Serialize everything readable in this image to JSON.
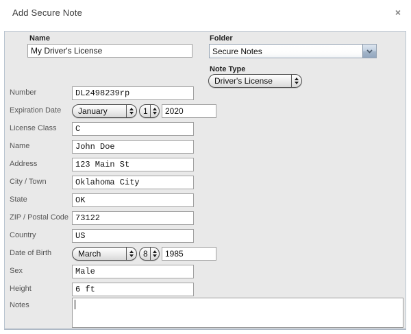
{
  "dialog": {
    "title": "Add Secure Note",
    "close_glyph": "×"
  },
  "header": {
    "name": {
      "label": "Name",
      "value": "My Driver's License"
    },
    "folder": {
      "label": "Folder",
      "value": "Secure Notes"
    },
    "note_type": {
      "label": "Note Type",
      "value": "Driver's License"
    }
  },
  "fields": {
    "number": {
      "label": "Number",
      "value": "DL2498239rp"
    },
    "expiration": {
      "label": "Expiration Date",
      "month": "January",
      "day": "1",
      "year": "2020"
    },
    "license_class": {
      "label": "License Class",
      "value": "C"
    },
    "name": {
      "label": "Name",
      "value": "John Doe"
    },
    "address": {
      "label": "Address",
      "value": "123 Main St"
    },
    "city": {
      "label": "City / Town",
      "value": "Oklahoma City"
    },
    "state": {
      "label": "State",
      "value": "OK"
    },
    "zip": {
      "label": "ZIP / Postal Code",
      "value": "73122"
    },
    "country": {
      "label": "Country",
      "value": "US"
    },
    "dob": {
      "label": "Date of Birth",
      "month": "March",
      "day": "8",
      "year": "1985"
    },
    "sex": {
      "label": "Sex",
      "value": "Male"
    },
    "height": {
      "label": "Height",
      "value": "6 ft"
    },
    "notes": {
      "label": "Notes",
      "value": ""
    }
  },
  "colors": {
    "panel_bg": "#e9e9e9",
    "panel_border": "#b9c4d0",
    "combo_button_blue": "#a3b5c9",
    "input_border": "#a0a0a0"
  }
}
